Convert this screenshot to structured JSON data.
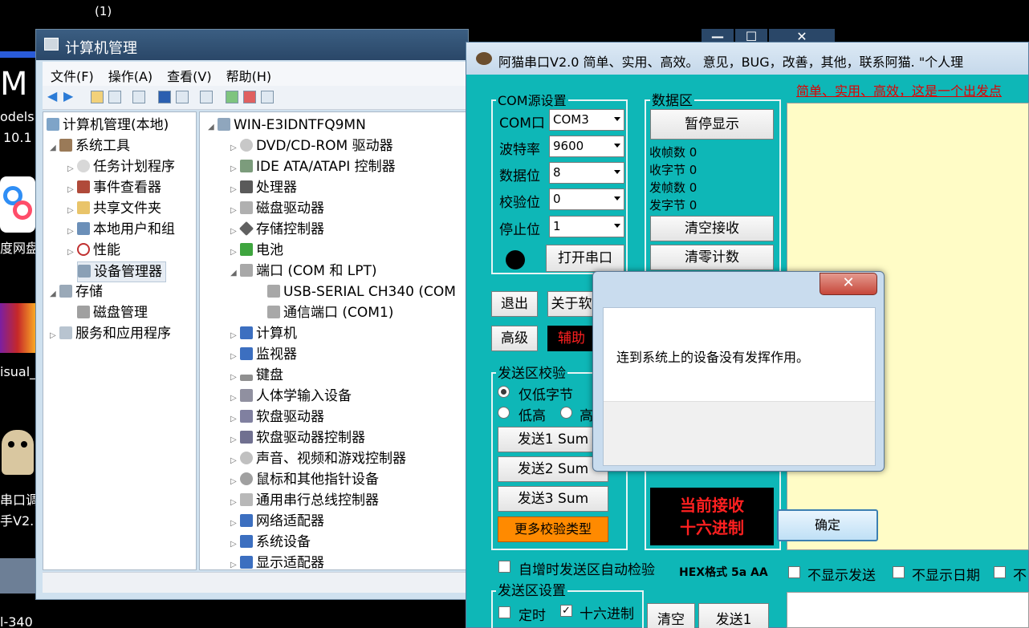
{
  "desktop": {
    "top_label": "(1)",
    "icon_labels": [
      "odelsi",
      "10.1",
      "度网盘",
      "isual_",
      "串口调",
      "手V2.",
      "l-340"
    ]
  },
  "computer_management": {
    "title": "计算机管理",
    "menu": [
      "文件(F)",
      "操作(A)",
      "查看(V)",
      "帮助(H)"
    ],
    "left_tree": [
      "计算机管理(本地)",
      "系统工具",
      "任务计划程序",
      "事件查看器",
      "共享文件夹",
      "本地用户和组",
      "性能",
      "设备管理器",
      "存储",
      "磁盘管理",
      "服务和应用程序"
    ],
    "device_root": "WIN-E3IDNTFQ9MN",
    "devices": [
      "DVD/CD-ROM 驱动器",
      "IDE ATA/ATAPI 控制器",
      "处理器",
      "磁盘驱动器",
      "存储控制器",
      "电池",
      "端口 (COM 和 LPT)",
      "USB-SERIAL CH340 (COM",
      "通信端口 (COM1)",
      "计算机",
      "监视器",
      "键盘",
      "人体学输入设备",
      "软盘驱动器",
      "软盘驱动器控制器",
      "声音、视频和游戏控制器",
      "鼠标和其他指针设备",
      "通用串行总线控制器",
      "网络适配器",
      "系统设备",
      "显示适配器"
    ]
  },
  "serial": {
    "title": "阿猫串口V2.0  简单、实用、高效。  意见，BUG，改善，其他，联系阿猫. \"个人理",
    "red_link": "简单、实用、高效，这是一个出发点",
    "com_group": "COM源设置",
    "com_label": "COM口",
    "com_value": "COM3",
    "baud_label": "波特率",
    "baud_value": "9600",
    "data_label": "数据位",
    "data_value": "8",
    "parity_label": "校验位",
    "parity_value": "0",
    "stop_label": "停止位",
    "stop_value": "1",
    "open_btn": "打开串口",
    "exit_btn": "退出",
    "about_btn": "关于软",
    "advanced_btn": "高级",
    "assist_btn": "辅助",
    "data_group": "数据区",
    "pause_btn": "暂停显示",
    "rx_frames": "收帧数 0",
    "rx_bytes": "收字节 0",
    "tx_frames": "发帧数 0",
    "tx_bytes": "发字节 0",
    "clear_recv_btn": "清空接收",
    "reset_count_btn": "清零计数",
    "checksum_group": "发送区校验",
    "radio_low": "仅低字节",
    "radio_lowhigh": "低高",
    "radio_high": "高",
    "send1_btn": "发送1 Sum",
    "send2_btn": "发送2 Sum",
    "send3_btn": "发送3 Sum",
    "more_btn": "更多校验类型",
    "recv_hex_line1": "当前接收",
    "recv_hex_line2": "十六进制",
    "auto_check": "自增时发送区自动检验",
    "hex_format": "HEX格式 5a AA",
    "hide_send": "不显示发送",
    "hide_date": "不显示日期",
    "hide_more": "不",
    "send_group": "发送区设置",
    "timer_chk": "定时",
    "hex_chk": "十六进制",
    "clear_btn": "清空",
    "send_btn": "发送1"
  },
  "dialog": {
    "close": "✕",
    "message": "连到系统上的设备没有发挥作用。",
    "ok": "确定"
  },
  "back_window_buttons": [
    "—",
    "☐",
    "✕"
  ]
}
